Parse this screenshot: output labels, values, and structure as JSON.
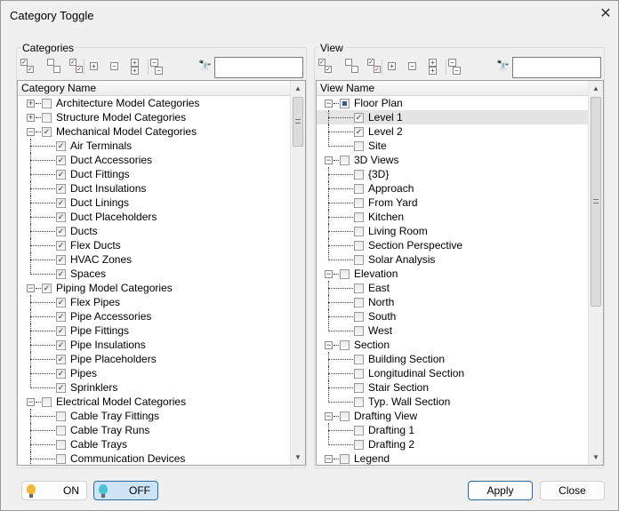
{
  "window": {
    "title": "Category Toggle",
    "close": "✕"
  },
  "colors": {
    "on_bulb": "#f5b93a",
    "off_bulb": "#4cc3d0",
    "accent": "#2a6aa0"
  },
  "categories": {
    "label": "Categories",
    "header": "Category Name",
    "search_placeholder": "",
    "search_value": "",
    "rows": [
      {
        "t": "Architecture Model Categories",
        "l": 0,
        "e": "+",
        "c": "u"
      },
      {
        "t": "Structure Model Categories",
        "l": 0,
        "e": "+",
        "c": "u"
      },
      {
        "t": "Mechanical Model Categories",
        "l": 0,
        "e": "-",
        "c": "c"
      },
      {
        "t": "Air Terminals",
        "l": 1,
        "c": "c"
      },
      {
        "t": "Duct Accessories",
        "l": 1,
        "c": "c"
      },
      {
        "t": "Duct Fittings",
        "l": 1,
        "c": "c"
      },
      {
        "t": "Duct Insulations",
        "l": 1,
        "c": "c"
      },
      {
        "t": "Duct Linings",
        "l": 1,
        "c": "c"
      },
      {
        "t": "Duct Placeholders",
        "l": 1,
        "c": "c"
      },
      {
        "t": "Ducts",
        "l": 1,
        "c": "c"
      },
      {
        "t": "Flex Ducts",
        "l": 1,
        "c": "c"
      },
      {
        "t": "HVAC Zones",
        "l": 1,
        "c": "c"
      },
      {
        "t": "Spaces",
        "l": 1,
        "c": "c",
        "last": true
      },
      {
        "t": "Piping Model Categories",
        "l": 0,
        "e": "-",
        "c": "c"
      },
      {
        "t": "Flex Pipes",
        "l": 1,
        "c": "c"
      },
      {
        "t": "Pipe Accessories",
        "l": 1,
        "c": "c"
      },
      {
        "t": "Pipe Fittings",
        "l": 1,
        "c": "c"
      },
      {
        "t": "Pipe Insulations",
        "l": 1,
        "c": "c"
      },
      {
        "t": "Pipe Placeholders",
        "l": 1,
        "c": "c"
      },
      {
        "t": "Pipes",
        "l": 1,
        "c": "c"
      },
      {
        "t": "Sprinklers",
        "l": 1,
        "c": "c",
        "last": true
      },
      {
        "t": "Electrical Model Categories",
        "l": 0,
        "e": "-",
        "c": "u"
      },
      {
        "t": "Cable Tray Fittings",
        "l": 1,
        "c": "u"
      },
      {
        "t": "Cable Tray Runs",
        "l": 1,
        "c": "u"
      },
      {
        "t": "Cable Trays",
        "l": 1,
        "c": "u"
      },
      {
        "t": "Communication Devices",
        "l": 1,
        "c": "u"
      }
    ]
  },
  "view": {
    "label": "View",
    "header": "View Name",
    "search_placeholder": "",
    "search_value": "",
    "rows": [
      {
        "t": "Floor Plan",
        "l": 0,
        "e": "-",
        "c": "p"
      },
      {
        "t": "Level 1",
        "l": 1,
        "c": "c",
        "sel": true
      },
      {
        "t": "Level 2",
        "l": 1,
        "c": "c"
      },
      {
        "t": "Site",
        "l": 1,
        "c": "u",
        "last": true
      },
      {
        "t": "3D Views",
        "l": 0,
        "e": "-",
        "c": "u"
      },
      {
        "t": "{3D}",
        "l": 1,
        "c": "u"
      },
      {
        "t": "Approach",
        "l": 1,
        "c": "u"
      },
      {
        "t": "From Yard",
        "l": 1,
        "c": "u"
      },
      {
        "t": "Kitchen",
        "l": 1,
        "c": "u"
      },
      {
        "t": "Living Room",
        "l": 1,
        "c": "u"
      },
      {
        "t": "Section Perspective",
        "l": 1,
        "c": "u"
      },
      {
        "t": "Solar Analysis",
        "l": 1,
        "c": "u",
        "last": true
      },
      {
        "t": "Elevation",
        "l": 0,
        "e": "-",
        "c": "u"
      },
      {
        "t": "East",
        "l": 1,
        "c": "u"
      },
      {
        "t": "North",
        "l": 1,
        "c": "u"
      },
      {
        "t": "South",
        "l": 1,
        "c": "u"
      },
      {
        "t": "West",
        "l": 1,
        "c": "u",
        "last": true
      },
      {
        "t": "Section",
        "l": 0,
        "e": "-",
        "c": "u"
      },
      {
        "t": "Building Section",
        "l": 1,
        "c": "u"
      },
      {
        "t": "Longitudinal Section",
        "l": 1,
        "c": "u"
      },
      {
        "t": "Stair Section",
        "l": 1,
        "c": "u"
      },
      {
        "t": "Typ. Wall Section",
        "l": 1,
        "c": "u",
        "last": true
      },
      {
        "t": "Drafting View",
        "l": 0,
        "e": "-",
        "c": "u"
      },
      {
        "t": "Drafting 1",
        "l": 1,
        "c": "u"
      },
      {
        "t": "Drafting 2",
        "l": 1,
        "c": "u",
        "last": true
      },
      {
        "t": "Legend",
        "l": 0,
        "e": "-",
        "c": "u"
      }
    ]
  },
  "footer": {
    "on": "ON",
    "off": "OFF",
    "apply": "Apply",
    "close": "Close"
  }
}
